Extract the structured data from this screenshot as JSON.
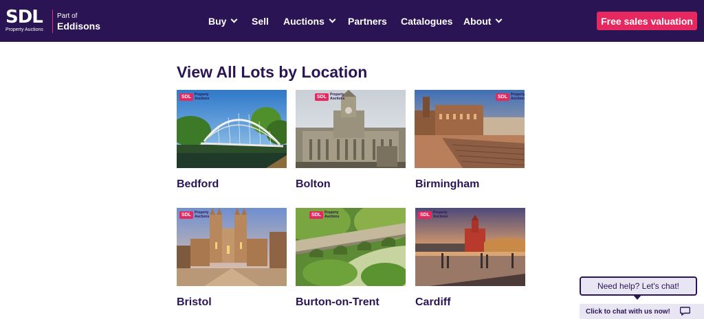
{
  "brand": {
    "logo_text": "SDL",
    "logo_sub": "Property Auctions",
    "part_of": "Part of",
    "parent": "Eddisons",
    "accent_color": "#e5285f",
    "nav_bg": "#2a1453"
  },
  "nav": {
    "buy": "Buy",
    "sell": "Sell",
    "auctions": "Auctions",
    "partners": "Partners",
    "catalogues": "Catalogues",
    "about": "About",
    "cta": "Free sales valuation"
  },
  "main": {
    "heading": "View All Lots by Location",
    "badge_main": "SDL",
    "badge_sub": "Property Auctions",
    "locations": [
      {
        "name": "Bedford"
      },
      {
        "name": "Bolton"
      },
      {
        "name": "Birmingham"
      },
      {
        "name": "Bristol"
      },
      {
        "name": "Burton-on-Trent"
      },
      {
        "name": "Cardiff"
      }
    ]
  },
  "chat": {
    "bubble": "Need help? Let's chat!",
    "bar": "Click to chat with us now!"
  }
}
